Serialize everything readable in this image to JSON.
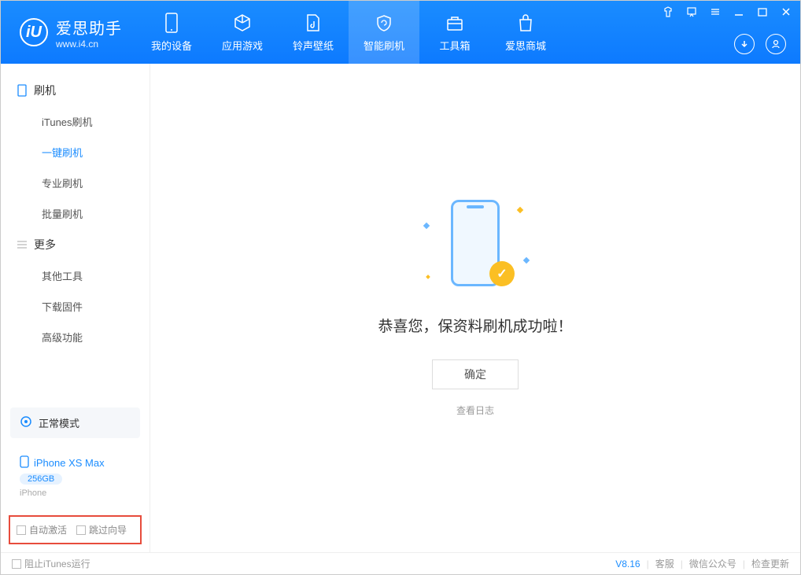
{
  "app": {
    "title": "爱思助手",
    "subtitle": "www.i4.cn"
  },
  "nav": [
    {
      "label": "我的设备"
    },
    {
      "label": "应用游戏"
    },
    {
      "label": "铃声壁纸"
    },
    {
      "label": "智能刷机"
    },
    {
      "label": "工具箱"
    },
    {
      "label": "爱思商城"
    }
  ],
  "sidebar": {
    "group1": "刷机",
    "items1": [
      "iTunes刷机",
      "一键刷机",
      "专业刷机",
      "批量刷机"
    ],
    "group2": "更多",
    "items2": [
      "其他工具",
      "下载固件",
      "高级功能"
    ],
    "mode": "正常模式",
    "device": {
      "name": "iPhone XS Max",
      "storage": "256GB",
      "type": "iPhone"
    },
    "checks": {
      "auto_activate": "自动激活",
      "skip_guide": "跳过向导"
    }
  },
  "main": {
    "message": "恭喜您，保资料刷机成功啦！",
    "ok": "确定",
    "view_log": "查看日志"
  },
  "footer": {
    "block_itunes": "阻止iTunes运行",
    "version": "V8.16",
    "support": "客服",
    "wechat": "微信公众号",
    "update": "检查更新"
  }
}
